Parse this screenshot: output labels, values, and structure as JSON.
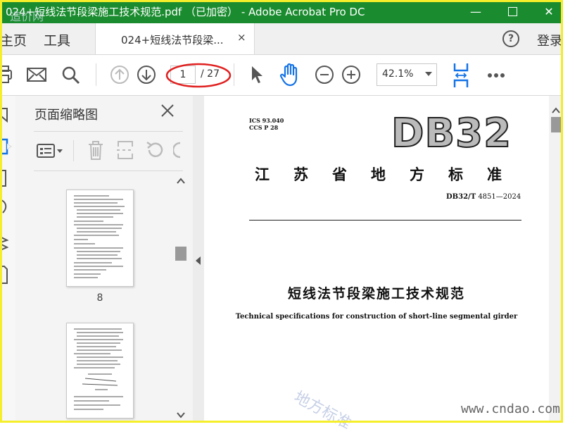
{
  "window": {
    "title": "024+短线法节段梁施工技术规范.pdf （已加密） - Adobe Acrobat Pro DC",
    "watermark_top": "造价网",
    "controls": [
      "minimize",
      "maximize",
      "close"
    ]
  },
  "menu": {
    "home": "主页",
    "tools": "工具",
    "doc_tab": "024+短线法节段梁...",
    "doc_tab_close": "×",
    "help": "?",
    "login": "登录"
  },
  "toolbar": {
    "page_current": "1",
    "page_total": "/ 27",
    "zoom": "42.1%",
    "icons": [
      "print-icon",
      "mail-icon",
      "search-icon",
      "prev-page-icon",
      "next-page-icon",
      "select-arrow-icon",
      "hand-tool-icon",
      "zoom-out-icon",
      "zoom-in-icon",
      "fit-width-icon",
      "more-icon"
    ],
    "accent_color": "#1473e6"
  },
  "panel": {
    "title": "页面缩略图",
    "thumbnails": [
      {
        "page": "8"
      },
      {
        "page": ""
      }
    ]
  },
  "document": {
    "ics_line1": "ICS  93.040",
    "ics_line2": "CCS  P  28",
    "logo": "DB32",
    "province": "江苏省地方标准",
    "std_prefix": "DB32/T",
    "std_number": " 4851—2024",
    "title_cn": "短线法节段梁施工技术规范",
    "title_en": "Technical specifications for construction of short-line segmental girder"
  },
  "watermarks": {
    "middle": "地方标准",
    "bottom_right": "www.cndao.com"
  }
}
